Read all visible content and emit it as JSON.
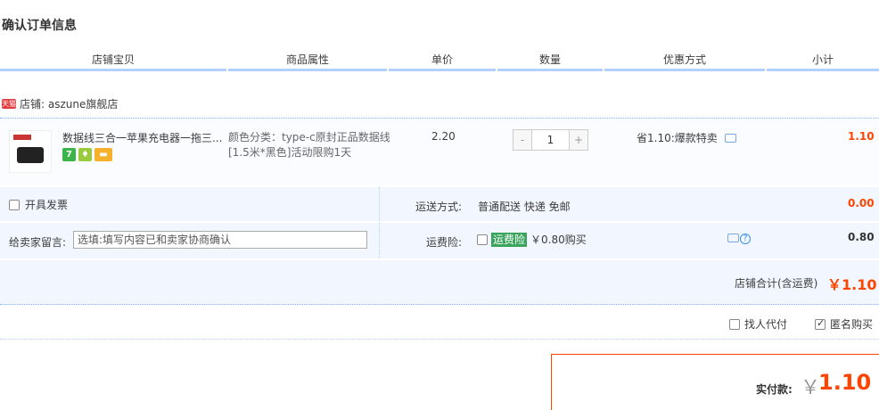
{
  "page_title": "确认订单信息",
  "columns": [
    "店铺宝贝",
    "商品属性",
    "单价",
    "数量",
    "优惠方式",
    "小计"
  ],
  "shop": {
    "badge": "天猫",
    "label": "店铺: aszune旗舰店"
  },
  "item": {
    "title": "数据线三合一苹果充电器一拖三...",
    "attr_line1": "颜色分类：type-c原封正品数据线",
    "attr_line2": "[1.5米*黑色]活动限购1天",
    "price": "2.20",
    "qty_minus": "-",
    "qty_value": "1",
    "qty_plus": "+",
    "promo": "省1.10:爆款特卖",
    "subtotal": "1.10"
  },
  "invoice": {
    "label": "开具发票"
  },
  "shipping": {
    "label": "运送方式:",
    "value": "普通配送 快递 免邮",
    "amount": "0.00"
  },
  "remark": {
    "label": "给卖家留言:",
    "placeholder": "选填:填写内容已和卖家协商确认"
  },
  "insurance": {
    "label": "运费险:",
    "tag": "运费险",
    "price": "￥0.80购买",
    "amount": "0.80"
  },
  "shop_total": {
    "label": "店铺合计(含运费)",
    "value": "￥1.10"
  },
  "options": {
    "proxy_pay": "找人代付",
    "anonymous": "匿名购买"
  },
  "pay": {
    "label": "实付款:",
    "currency": "￥",
    "value": "1.10"
  }
}
